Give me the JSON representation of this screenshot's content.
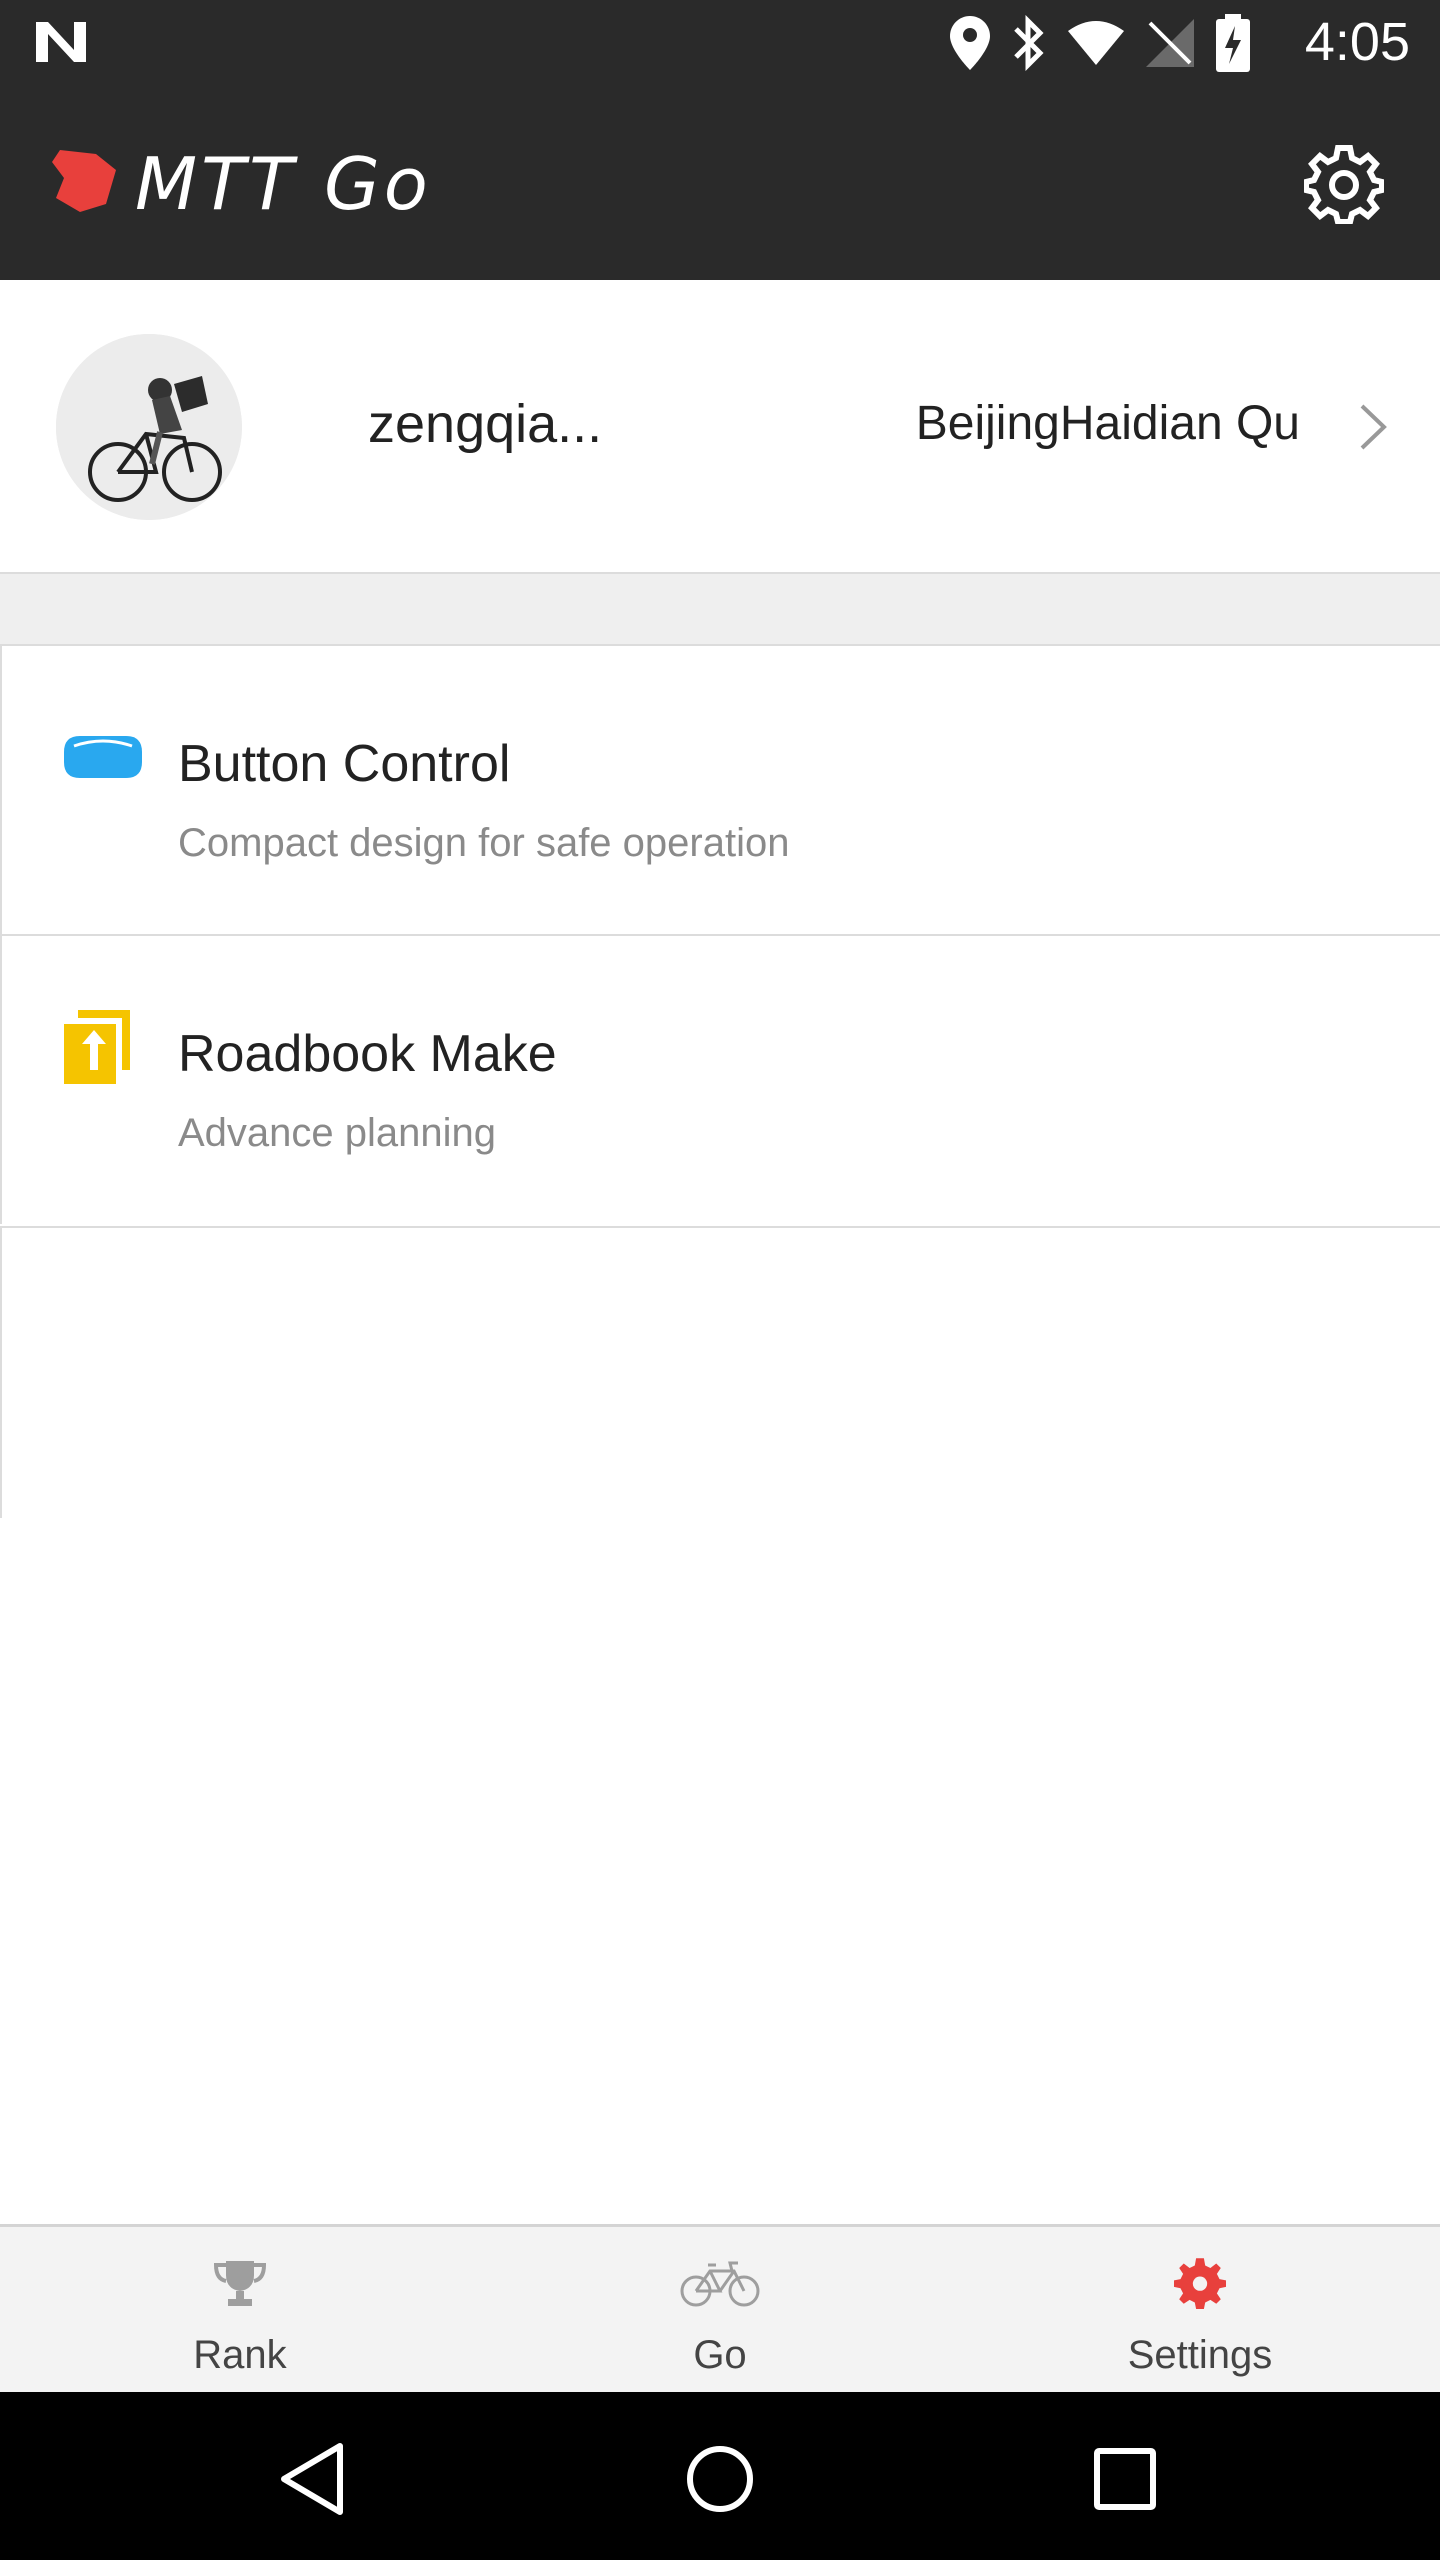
{
  "status_bar": {
    "time": "4:05",
    "icons": [
      "n-icon",
      "location-icon",
      "bluetooth-icon",
      "wifi-icon",
      "no-sim-icon",
      "battery-icon"
    ]
  },
  "app_bar": {
    "title": "MTT Go",
    "logo_color": "#e8403c"
  },
  "profile": {
    "username": "zengqia...",
    "location": "BeijingHaidian Qu"
  },
  "list": [
    {
      "title": "Button Control",
      "subtitle": "Compact design for safe operation",
      "icon": "button-device-icon",
      "icon_color": "#29a8ef"
    },
    {
      "title": "Roadbook Make",
      "subtitle": "Advance planning",
      "icon": "roadbook-icon",
      "icon_color": "#f5c400"
    }
  ],
  "bottom_nav": [
    {
      "label": "Rank",
      "icon": "trophy-icon",
      "active": false
    },
    {
      "label": "Go",
      "icon": "bicycle-icon",
      "active": false
    },
    {
      "label": "Settings",
      "icon": "gear-icon",
      "active": true
    }
  ],
  "colors": {
    "bar_bg": "#2a2a2a",
    "accent": "#e8403c",
    "inactive_icon": "#9e9e9e"
  }
}
